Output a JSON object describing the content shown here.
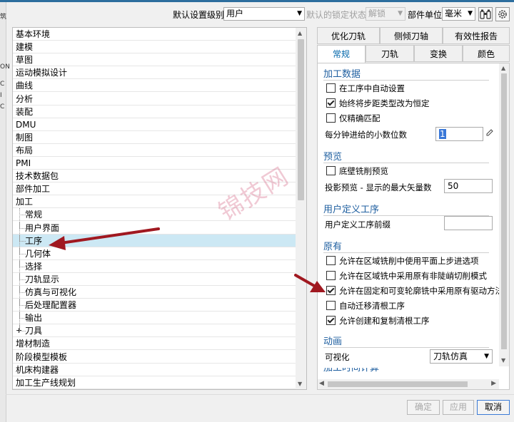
{
  "toolbar": {
    "default_level_label": "默认设置级别",
    "default_level_value": "用户",
    "lock_state_label": "默认的锁定状态",
    "lock_state_value": "解锁",
    "part_unit_label": "部件单位",
    "part_unit_value": "毫米"
  },
  "tree": {
    "items": [
      {
        "label": "基本环境",
        "indent": 0
      },
      {
        "label": "建模",
        "indent": 0
      },
      {
        "label": "草图",
        "indent": 0
      },
      {
        "label": "运动模拟设计",
        "indent": 0
      },
      {
        "label": "曲线",
        "indent": 0
      },
      {
        "label": "分析",
        "indent": 0
      },
      {
        "label": "装配",
        "indent": 0
      },
      {
        "label": "DMU",
        "indent": 0
      },
      {
        "label": "制图",
        "indent": 0
      },
      {
        "label": "布局",
        "indent": 0
      },
      {
        "label": "PMI",
        "indent": 0
      },
      {
        "label": "技术数据包",
        "indent": 0
      },
      {
        "label": "部件加工",
        "indent": 0
      },
      {
        "label": "加工",
        "indent": 0
      },
      {
        "label": "常规",
        "indent": 1
      },
      {
        "label": "用户界面",
        "indent": 1
      },
      {
        "label": "工序",
        "indent": 1,
        "selected": true
      },
      {
        "label": "几何体",
        "indent": 1
      },
      {
        "label": "选择",
        "indent": 1
      },
      {
        "label": "刀轨显示",
        "indent": 1
      },
      {
        "label": "仿真与可视化",
        "indent": 1
      },
      {
        "label": "后处理配置器",
        "indent": 1
      },
      {
        "label": "输出",
        "indent": 1
      },
      {
        "label": "刀具",
        "indent": 1,
        "expand": "+"
      },
      {
        "label": "增材制造",
        "indent": 0
      },
      {
        "label": "阶段模型模板",
        "indent": 0
      },
      {
        "label": "机床构建器",
        "indent": 0
      },
      {
        "label": "加工生产线规划",
        "indent": 0
      }
    ]
  },
  "tabs_top": [
    "优化刀轨",
    "侧倾刀轴",
    "有效性报告"
  ],
  "tabs_bottom": [
    "常规",
    "刀轨",
    "变换",
    "颜色"
  ],
  "settings": {
    "group1_title": "加工数据",
    "cb_auto_set": "在工序中自动设置",
    "cb_step_constant": "始终将步距类型改为恒定",
    "cb_exact_match": "仅精确匹配",
    "decimals_label": "每分钟进给的小数位数",
    "decimals_value": "1",
    "group2_title": "预览",
    "cb_floor_wall_preview": "底壁铣削预览",
    "proj_preview_label": "投影预览 - 显示的最大矢量数",
    "proj_preview_value": "50",
    "group3_title": "用户定义工序",
    "udo_prefix_label": "用户定义工序前缀",
    "udo_prefix_value": "",
    "group4_title": "原有",
    "cb_area_plane_stepover": "允许在区域铣削中使用平面上步进选项",
    "cb_area_nonsteep": "允许在区域铣中采用原有非陡峭切削模式",
    "cb_fixed_variable": "允许在固定和可变轮廓铣中采用原有驱动方法",
    "cb_auto_migrate": "自动迁移清根工序",
    "cb_create_copy": "允许创建和复制清根工序",
    "group5_title": "动画",
    "visual_label": "可视化",
    "visual_value": "刀轨仿真",
    "next_group_title": "加工时间计算"
  },
  "buttons": {
    "ok": "确定",
    "apply": "应用",
    "cancel": "取消"
  },
  "watermark": "锦技网",
  "left_strip_chars": [
    "筑",
    "ON",
    "C",
    "I",
    "C"
  ]
}
